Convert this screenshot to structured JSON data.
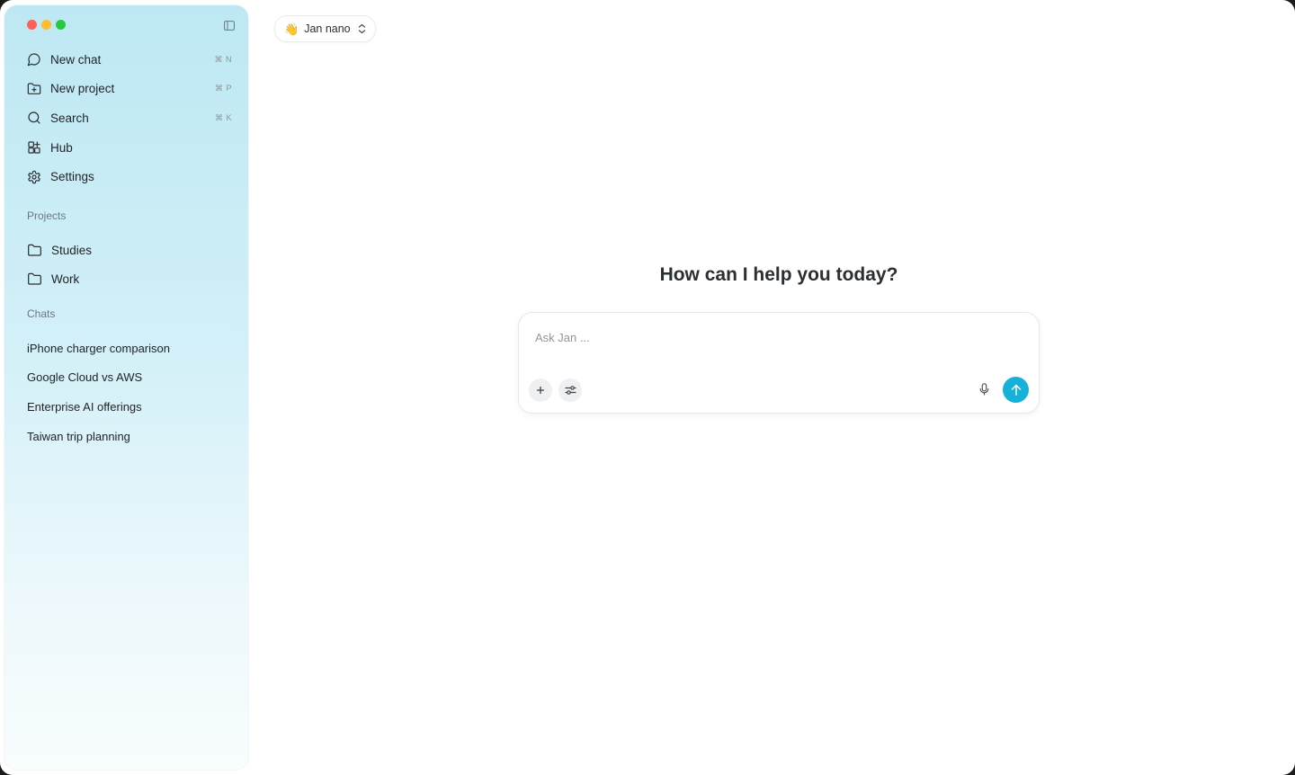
{
  "window": {
    "traffic_lights": [
      "close",
      "minimize",
      "zoom"
    ]
  },
  "sidebar": {
    "nav": [
      {
        "label": "New chat",
        "shortcut": "⌘ N",
        "icon": "message-circle-icon"
      },
      {
        "label": "New project",
        "shortcut": "⌘ P",
        "icon": "folder-plus-icon"
      },
      {
        "label": "Search",
        "shortcut": "⌘ K",
        "icon": "search-icon"
      },
      {
        "label": "Hub",
        "shortcut": "",
        "icon": "grid-plus-icon"
      },
      {
        "label": "Settings",
        "shortcut": "",
        "icon": "gear-icon"
      }
    ],
    "projects_label": "Projects",
    "projects": [
      {
        "label": "Studies",
        "icon": "folder-icon"
      },
      {
        "label": "Work",
        "icon": "folder-icon"
      }
    ],
    "chats_label": "Chats",
    "chats": [
      {
        "label": "iPhone charger comparison"
      },
      {
        "label": "Google Cloud vs AWS"
      },
      {
        "label": "Enterprise AI offerings"
      },
      {
        "label": "Taiwan trip planning"
      }
    ]
  },
  "model_selector": {
    "emoji": "👋",
    "label": "Jan nano"
  },
  "main": {
    "heading": "How can I help you today?",
    "composer": {
      "placeholder": "Ask Jan ...",
      "value": ""
    }
  },
  "colors": {
    "accent": "#16b1d9",
    "sidebar_top": "#bde8f3",
    "sidebar_bottom": "#f8fdfe"
  }
}
